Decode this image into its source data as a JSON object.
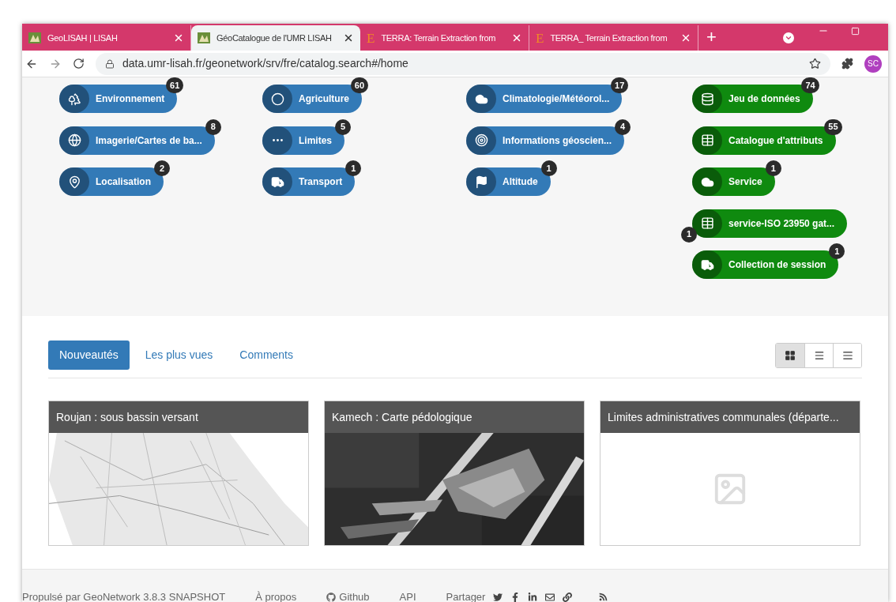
{
  "browser": {
    "tabs": [
      {
        "title": "GeoLISAH | LISAH",
        "selected": false,
        "kind": "logo"
      },
      {
        "title": "GéoCatalogue de l'UMR LISAH",
        "selected": true,
        "kind": "logo"
      },
      {
        "title": "TERRA: Terrain Extraction from",
        "selected": false,
        "kind": "letter",
        "favicon_letter": "E"
      },
      {
        "title": "TERRA_ Terrain Extraction from",
        "selected": false,
        "kind": "letter",
        "favicon_letter": "E"
      }
    ],
    "new_tab": "+",
    "url": "data.umr-lisah.fr/geonetwork/srv/fre/catalog.search#/home",
    "profile": "SC"
  },
  "categories": [
    {
      "items": [
        {
          "label": "Environnement",
          "count": "61",
          "color": "#337ab7"
        },
        {
          "label": "Imagerie/Cartes de ba...",
          "count": "8",
          "color": "#337ab7"
        },
        {
          "label": "Localisation",
          "count": "2",
          "color": "#337ab7"
        }
      ]
    },
    {
      "items": [
        {
          "label": "Agriculture",
          "count": "60",
          "color": "#337ab7"
        },
        {
          "label": "Limites",
          "count": "5",
          "color": "#337ab7"
        },
        {
          "label": "Transport",
          "count": "1",
          "color": "#337ab7"
        }
      ]
    },
    {
      "items": [
        {
          "label": "Climatologie/Météorol...",
          "count": "17",
          "color": "#337ab7"
        },
        {
          "label": "Informations géoscien...",
          "count": "4",
          "color": "#337ab7"
        },
        {
          "label": "Altitude",
          "count": "1",
          "color": "#337ab7"
        }
      ]
    },
    {
      "items": [
        {
          "label": "Jeu de données",
          "count": "74",
          "color": "#0f8a0f",
          "badge_left": false
        },
        {
          "label": "Catalogue d'attributs",
          "count": "55",
          "color": "#0f8a0f",
          "badge_left": false
        },
        {
          "label": "Service",
          "count": "1",
          "color": "#0f8a0f",
          "badge_left": false
        },
        {
          "label": "service-ISO 23950 gat...",
          "count": "1",
          "color": "#0f8a0f",
          "badge_left": true
        },
        {
          "label": "Collection de session",
          "count": "1",
          "color": "#0f8a0f",
          "badge_left": false
        }
      ]
    }
  ],
  "result_tabs": [
    {
      "label": "Nouveautés",
      "selected": true
    },
    {
      "label": "Les plus vues",
      "selected": false
    },
    {
      "label": "Comments",
      "selected": false
    }
  ],
  "view_modes": [
    {
      "selected": true
    },
    {
      "selected": false
    },
    {
      "selected": false
    }
  ],
  "cards": [
    {
      "title": "Roujan : sous bassin versant",
      "kind": "picture"
    },
    {
      "title": "Kamech : Carte pédologique",
      "kind": "picture"
    },
    {
      "title": "Limites administratives communales (départe...",
      "kind": "placeholder"
    }
  ],
  "footer": {
    "powered_by": "Propulsé par GeoNetwork 3.8.3 SNAPSHOT",
    "links": [
      "À propos",
      "Github",
      "API"
    ],
    "share": "Partager"
  }
}
